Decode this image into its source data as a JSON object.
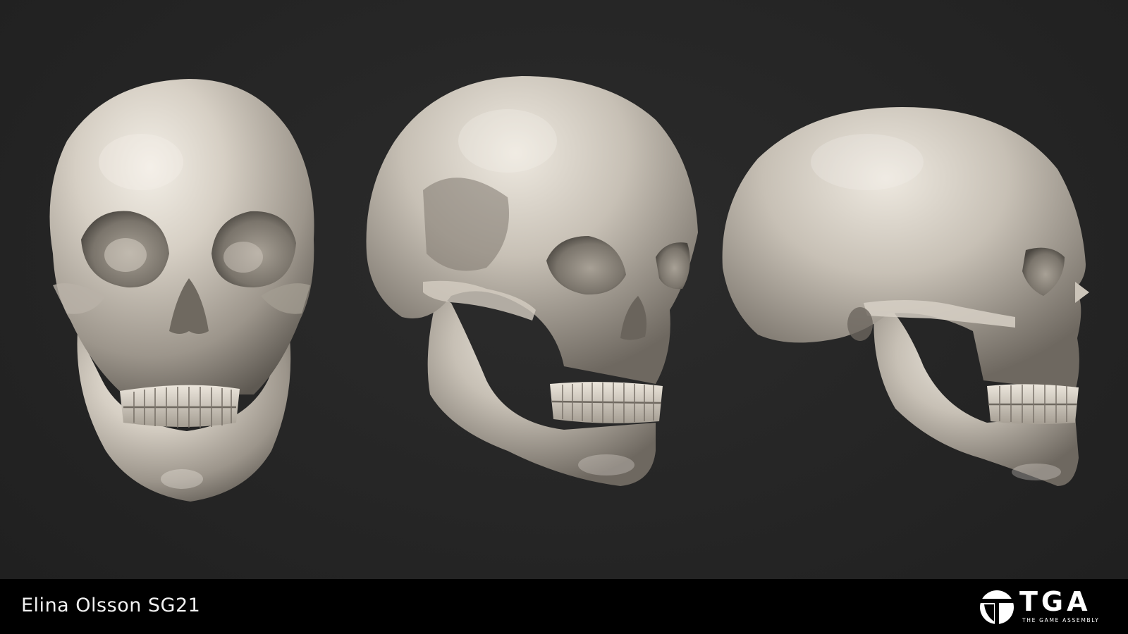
{
  "footer": {
    "artist_credit": "Elina Olsson SG21",
    "logo": {
      "wordmark": "TGA",
      "tagline": "THE GAME ASSEMBLY"
    }
  },
  "render": {
    "views": [
      "front",
      "three-quarter",
      "side"
    ],
    "subject": "skull",
    "colors": {
      "background": "#252525",
      "bone": "#cdc6bb",
      "footer": "#000000"
    }
  }
}
